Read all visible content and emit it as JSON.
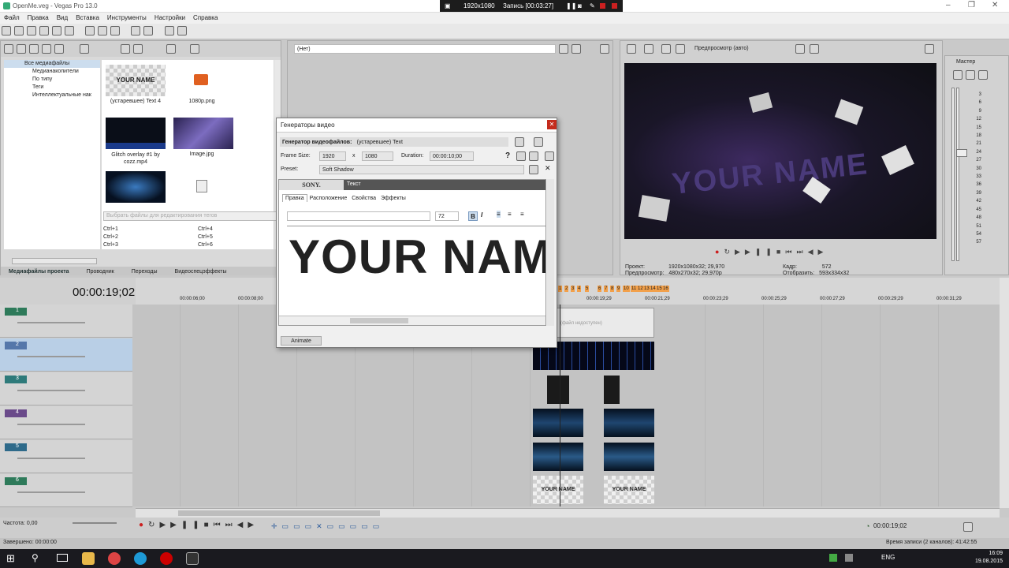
{
  "window": {
    "title": "OpenMe.veg - Vegas Pro 13.0"
  },
  "capture_bar": {
    "resolution": "1920x1080",
    "recording": "Запись [00:03:27]"
  },
  "menu": [
    "Файл",
    "Правка",
    "Вид",
    "Вставка",
    "Инструменты",
    "Настройки",
    "Справка"
  ],
  "explorer": {
    "tree": [
      "Все медиафайлы",
      "Медианакопители",
      "По типу",
      "Теги",
      "Интеллектуальные нак"
    ],
    "files": [
      {
        "name": "(устаревшее) Text 4",
        "thumb_text": "YOUR NAME"
      },
      {
        "name": "1080p.png"
      },
      {
        "name": "Glitch overlay #1 by cozz.mp4"
      },
      {
        "name": "Image.jpg"
      },
      {
        "name": ""
      },
      {
        "name": ""
      }
    ],
    "tag_placeholder": "Выбрать файлы для редактирования тегов",
    "shortcuts": [
      "Ctrl+1",
      "Ctrl+2",
      "Ctrl+3",
      "Ctrl+4",
      "Ctrl+5",
      "Ctrl+6"
    ],
    "tabs": [
      "Медиафайлы проекта",
      "Проводник",
      "Переходы",
      "Видеоспецэффекты"
    ]
  },
  "fx_preset": {
    "value": "(Нет)"
  },
  "preview": {
    "mode": "Предпросмотр (авто)",
    "overlay_text": "YOUR NAME",
    "info": {
      "project_label": "Проект:",
      "project": "1920x1080x32; 29,970",
      "preview_label": "Предпросмотр:",
      "preview": "480x270x32; 29,970p",
      "frame_label": "Кадр:",
      "frame": "572",
      "display_label": "Отобразить:",
      "display": "593x334x32"
    }
  },
  "mixer": {
    "title": "Мастер",
    "scale": [
      "3",
      "6",
      "9",
      "12",
      "15",
      "18",
      "21",
      "24",
      "27",
      "30",
      "33",
      "36",
      "39",
      "42",
      "45",
      "48",
      "51",
      "54",
      "57"
    ]
  },
  "dialog": {
    "title": "Генераторы видео",
    "generator_label": "Генератор видеофайлов:",
    "generator_value": "(устаревшее) Text",
    "frame_size_label": "Frame Size:",
    "width": "1920",
    "x": "x",
    "height": "1080",
    "duration_label": "Duration:",
    "duration": "00:00:10;00",
    "preset_label": "Preset:",
    "preset": "Soft Shadow",
    "brand": "SONY.",
    "plugin_tab": "Текст",
    "tabs": [
      "Правка",
      "Расположение",
      "Свойства",
      "Эффекты"
    ],
    "font_size": "72",
    "text": "YOUR NAM",
    "animate": "Animate"
  },
  "timeline": {
    "timecode": "00:00:19;02",
    "ruler": [
      "00:00:06;00",
      "00:00:08;00",
      "00:00:19;29",
      "00:00:21;29",
      "00:00:23;29",
      "00:00:25;29",
      "00:00:27;29",
      "00:00:29;29",
      "00:00:31;29"
    ],
    "markers": [
      "1",
      "2",
      "3",
      "4",
      "5",
      "6",
      "7",
      "8",
      "9",
      "10",
      "11",
      "12",
      "13",
      "14",
      "15",
      "16"
    ],
    "tracks": [
      "1",
      "2",
      "3",
      "4",
      "5",
      "6"
    ],
    "clip_texts": [
      "YOUR NAME",
      "YOUR NAME"
    ],
    "offline_text": "(файл недоступен)"
  },
  "transport": {
    "rate": "Частота: 0,00",
    "time": "00:00:19;02"
  },
  "status": {
    "left": "Завершено: 00:00:00",
    "right": "Время записи (2 каналов): 41:42:55"
  },
  "tray": {
    "lang": "ENG",
    "time": "16:09",
    "date": "19.08.2015"
  },
  "colors": {
    "accent": "#3b6ea5",
    "record": "#cc2020",
    "track2": "#5577aa"
  }
}
